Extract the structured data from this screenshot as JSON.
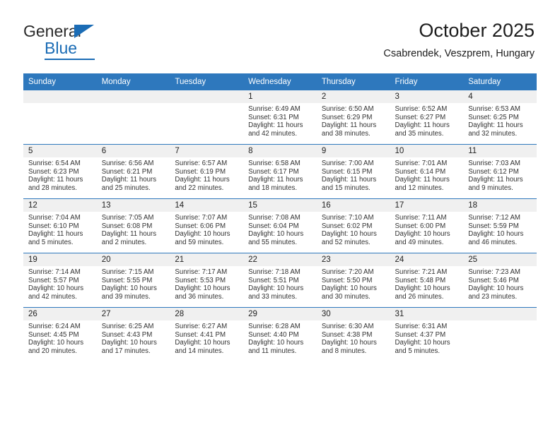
{
  "brand": {
    "name_line1": "General",
    "name_line2": "Blue",
    "color_primary": "#1b6cb5"
  },
  "header": {
    "title": "October 2025",
    "subtitle": "Csabrendek, Veszprem, Hungary",
    "header_bg": "#2e78bd",
    "day_band_bg": "#f0f0f0"
  },
  "calendar": {
    "weekday_headers": [
      "Sunday",
      "Monday",
      "Tuesday",
      "Wednesday",
      "Thursday",
      "Friday",
      "Saturday"
    ],
    "labels": {
      "sunrise": "Sunrise:",
      "sunset": "Sunset:",
      "daylight": "Daylight:"
    },
    "weeks": [
      [
        {
          "date": "",
          "empty": true
        },
        {
          "date": "",
          "empty": true
        },
        {
          "date": "",
          "empty": true
        },
        {
          "date": "1",
          "sunrise": "Sunrise: 6:49 AM",
          "sunset": "Sunset: 6:31 PM",
          "daylight_l1": "Daylight: 11 hours",
          "daylight_l2": "and 42 minutes."
        },
        {
          "date": "2",
          "sunrise": "Sunrise: 6:50 AM",
          "sunset": "Sunset: 6:29 PM",
          "daylight_l1": "Daylight: 11 hours",
          "daylight_l2": "and 38 minutes."
        },
        {
          "date": "3",
          "sunrise": "Sunrise: 6:52 AM",
          "sunset": "Sunset: 6:27 PM",
          "daylight_l1": "Daylight: 11 hours",
          "daylight_l2": "and 35 minutes."
        },
        {
          "date": "4",
          "sunrise": "Sunrise: 6:53 AM",
          "sunset": "Sunset: 6:25 PM",
          "daylight_l1": "Daylight: 11 hours",
          "daylight_l2": "and 32 minutes."
        }
      ],
      [
        {
          "date": "5",
          "sunrise": "Sunrise: 6:54 AM",
          "sunset": "Sunset: 6:23 PM",
          "daylight_l1": "Daylight: 11 hours",
          "daylight_l2": "and 28 minutes."
        },
        {
          "date": "6",
          "sunrise": "Sunrise: 6:56 AM",
          "sunset": "Sunset: 6:21 PM",
          "daylight_l1": "Daylight: 11 hours",
          "daylight_l2": "and 25 minutes."
        },
        {
          "date": "7",
          "sunrise": "Sunrise: 6:57 AM",
          "sunset": "Sunset: 6:19 PM",
          "daylight_l1": "Daylight: 11 hours",
          "daylight_l2": "and 22 minutes."
        },
        {
          "date": "8",
          "sunrise": "Sunrise: 6:58 AM",
          "sunset": "Sunset: 6:17 PM",
          "daylight_l1": "Daylight: 11 hours",
          "daylight_l2": "and 18 minutes."
        },
        {
          "date": "9",
          "sunrise": "Sunrise: 7:00 AM",
          "sunset": "Sunset: 6:15 PM",
          "daylight_l1": "Daylight: 11 hours",
          "daylight_l2": "and 15 minutes."
        },
        {
          "date": "10",
          "sunrise": "Sunrise: 7:01 AM",
          "sunset": "Sunset: 6:14 PM",
          "daylight_l1": "Daylight: 11 hours",
          "daylight_l2": "and 12 minutes."
        },
        {
          "date": "11",
          "sunrise": "Sunrise: 7:03 AM",
          "sunset": "Sunset: 6:12 PM",
          "daylight_l1": "Daylight: 11 hours",
          "daylight_l2": "and 9 minutes."
        }
      ],
      [
        {
          "date": "12",
          "sunrise": "Sunrise: 7:04 AM",
          "sunset": "Sunset: 6:10 PM",
          "daylight_l1": "Daylight: 11 hours",
          "daylight_l2": "and 5 minutes."
        },
        {
          "date": "13",
          "sunrise": "Sunrise: 7:05 AM",
          "sunset": "Sunset: 6:08 PM",
          "daylight_l1": "Daylight: 11 hours",
          "daylight_l2": "and 2 minutes."
        },
        {
          "date": "14",
          "sunrise": "Sunrise: 7:07 AM",
          "sunset": "Sunset: 6:06 PM",
          "daylight_l1": "Daylight: 10 hours",
          "daylight_l2": "and 59 minutes."
        },
        {
          "date": "15",
          "sunrise": "Sunrise: 7:08 AM",
          "sunset": "Sunset: 6:04 PM",
          "daylight_l1": "Daylight: 10 hours",
          "daylight_l2": "and 55 minutes."
        },
        {
          "date": "16",
          "sunrise": "Sunrise: 7:10 AM",
          "sunset": "Sunset: 6:02 PM",
          "daylight_l1": "Daylight: 10 hours",
          "daylight_l2": "and 52 minutes."
        },
        {
          "date": "17",
          "sunrise": "Sunrise: 7:11 AM",
          "sunset": "Sunset: 6:00 PM",
          "daylight_l1": "Daylight: 10 hours",
          "daylight_l2": "and 49 minutes."
        },
        {
          "date": "18",
          "sunrise": "Sunrise: 7:12 AM",
          "sunset": "Sunset: 5:59 PM",
          "daylight_l1": "Daylight: 10 hours",
          "daylight_l2": "and 46 minutes."
        }
      ],
      [
        {
          "date": "19",
          "sunrise": "Sunrise: 7:14 AM",
          "sunset": "Sunset: 5:57 PM",
          "daylight_l1": "Daylight: 10 hours",
          "daylight_l2": "and 42 minutes."
        },
        {
          "date": "20",
          "sunrise": "Sunrise: 7:15 AM",
          "sunset": "Sunset: 5:55 PM",
          "daylight_l1": "Daylight: 10 hours",
          "daylight_l2": "and 39 minutes."
        },
        {
          "date": "21",
          "sunrise": "Sunrise: 7:17 AM",
          "sunset": "Sunset: 5:53 PM",
          "daylight_l1": "Daylight: 10 hours",
          "daylight_l2": "and 36 minutes."
        },
        {
          "date": "22",
          "sunrise": "Sunrise: 7:18 AM",
          "sunset": "Sunset: 5:51 PM",
          "daylight_l1": "Daylight: 10 hours",
          "daylight_l2": "and 33 minutes."
        },
        {
          "date": "23",
          "sunrise": "Sunrise: 7:20 AM",
          "sunset": "Sunset: 5:50 PM",
          "daylight_l1": "Daylight: 10 hours",
          "daylight_l2": "and 30 minutes."
        },
        {
          "date": "24",
          "sunrise": "Sunrise: 7:21 AM",
          "sunset": "Sunset: 5:48 PM",
          "daylight_l1": "Daylight: 10 hours",
          "daylight_l2": "and 26 minutes."
        },
        {
          "date": "25",
          "sunrise": "Sunrise: 7:23 AM",
          "sunset": "Sunset: 5:46 PM",
          "daylight_l1": "Daylight: 10 hours",
          "daylight_l2": "and 23 minutes."
        }
      ],
      [
        {
          "date": "26",
          "sunrise": "Sunrise: 6:24 AM",
          "sunset": "Sunset: 4:45 PM",
          "daylight_l1": "Daylight: 10 hours",
          "daylight_l2": "and 20 minutes."
        },
        {
          "date": "27",
          "sunrise": "Sunrise: 6:25 AM",
          "sunset": "Sunset: 4:43 PM",
          "daylight_l1": "Daylight: 10 hours",
          "daylight_l2": "and 17 minutes."
        },
        {
          "date": "28",
          "sunrise": "Sunrise: 6:27 AM",
          "sunset": "Sunset: 4:41 PM",
          "daylight_l1": "Daylight: 10 hours",
          "daylight_l2": "and 14 minutes."
        },
        {
          "date": "29",
          "sunrise": "Sunrise: 6:28 AM",
          "sunset": "Sunset: 4:40 PM",
          "daylight_l1": "Daylight: 10 hours",
          "daylight_l2": "and 11 minutes."
        },
        {
          "date": "30",
          "sunrise": "Sunrise: 6:30 AM",
          "sunset": "Sunset: 4:38 PM",
          "daylight_l1": "Daylight: 10 hours",
          "daylight_l2": "and 8 minutes."
        },
        {
          "date": "31",
          "sunrise": "Sunrise: 6:31 AM",
          "sunset": "Sunset: 4:37 PM",
          "daylight_l1": "Daylight: 10 hours",
          "daylight_l2": "and 5 minutes."
        },
        {
          "date": "",
          "empty": true
        }
      ]
    ]
  }
}
